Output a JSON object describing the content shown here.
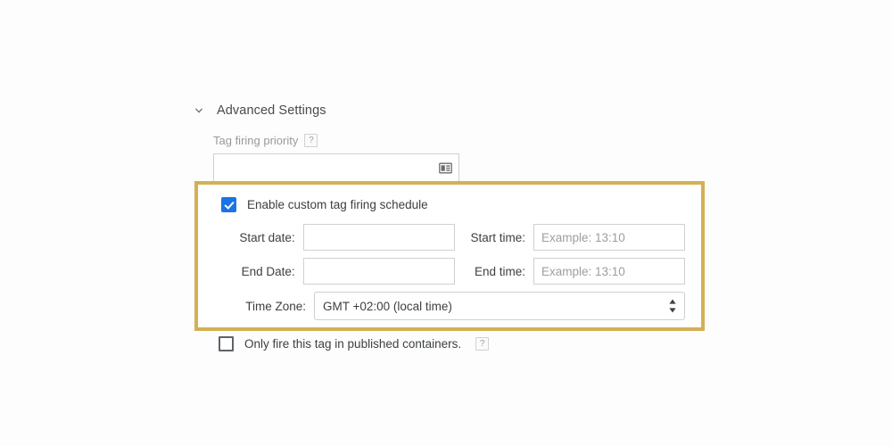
{
  "section": {
    "title": "Advanced Settings",
    "chevron_icon": "chevron-down-icon"
  },
  "priority": {
    "label": "Tag firing priority",
    "help_icon": "?",
    "value": "",
    "placeholder": "",
    "picker_icon": "variable-picker-icon"
  },
  "schedule": {
    "enable_label": "Enable custom tag firing schedule",
    "enabled": true,
    "start_date": {
      "label": "Start date:",
      "value": "",
      "placeholder": ""
    },
    "start_time": {
      "label": "Start time:",
      "value": "",
      "placeholder": "Example: 13:10"
    },
    "end_date": {
      "label": "End Date:",
      "value": "",
      "placeholder": ""
    },
    "end_time": {
      "label": "End time:",
      "value": "",
      "placeholder": "Example: 13:10"
    },
    "timezone": {
      "label": "Time Zone:",
      "selected": "GMT +02:00 (local time)",
      "options": [
        "GMT +02:00 (local time)"
      ]
    },
    "highlight_color": "#d4b054"
  },
  "published": {
    "label": "Only fire this tag in published containers.",
    "checked": false,
    "help_icon": "?"
  },
  "colors": {
    "accent_blue": "#1a73e8",
    "highlight_gold": "#d4b054",
    "page_background": "#fdfdfd",
    "text": "#3c4043",
    "muted_text": "#9a9a9a",
    "input_border": "#cfcfcf"
  }
}
